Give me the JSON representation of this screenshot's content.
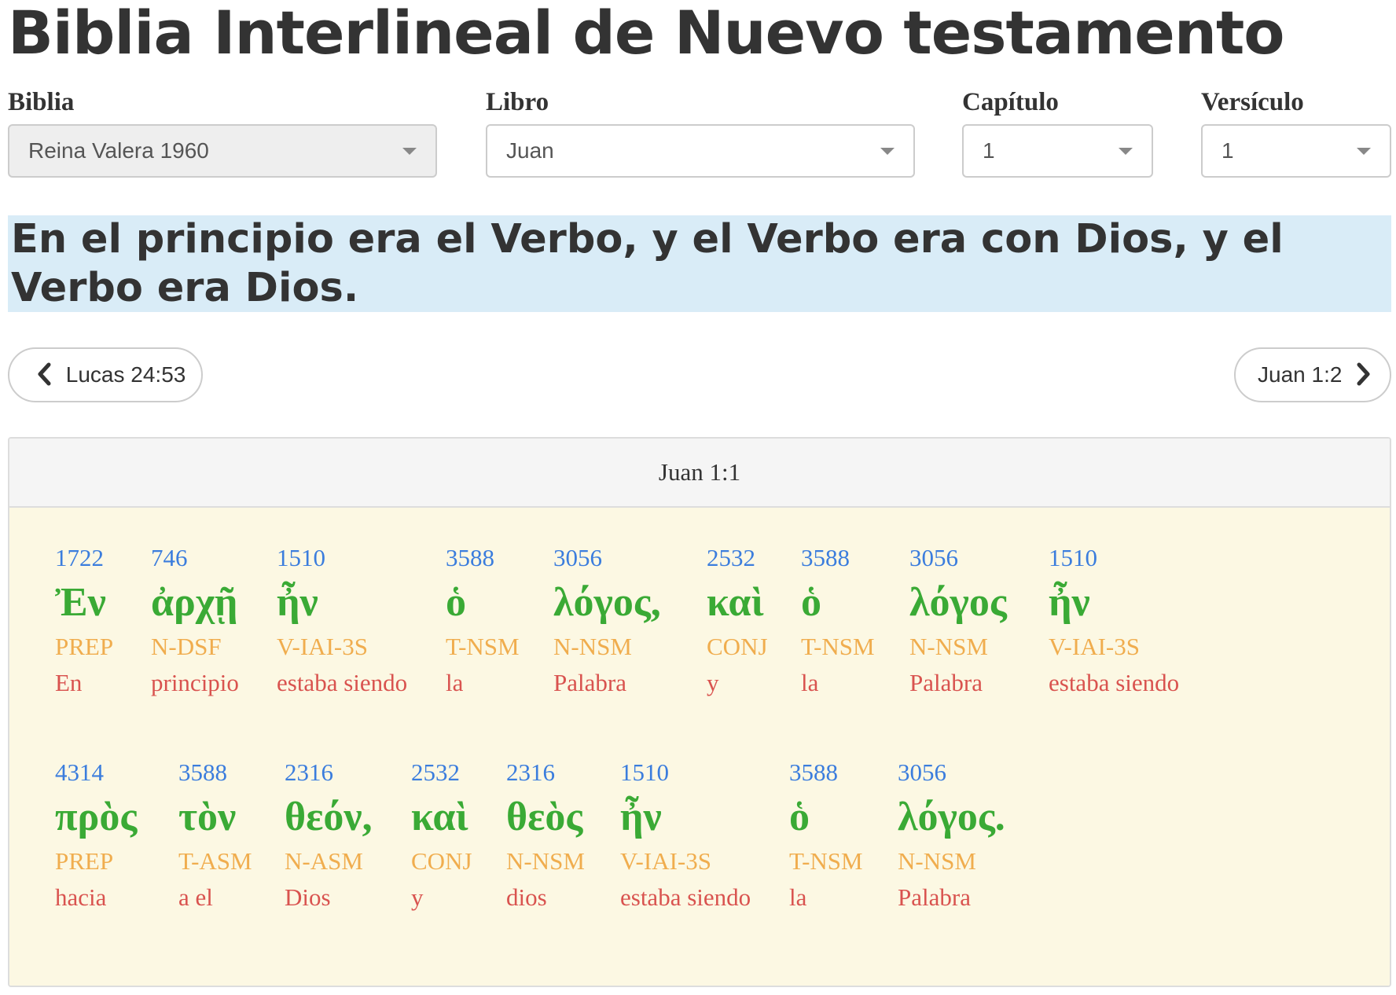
{
  "page": {
    "title": "Biblia Interlineal de Nuevo testamento"
  },
  "selectors": {
    "biblia": {
      "label": "Biblia",
      "value": "Reina Valera 1960",
      "disabled": true
    },
    "libro": {
      "label": "Libro",
      "value": "Juan"
    },
    "capitulo": {
      "label": "Capítulo",
      "value": "1"
    },
    "versiculo": {
      "label": "Versículo",
      "value": "1"
    }
  },
  "verse": {
    "text": "En el principio era el Verbo, y el Verbo era con Dios, y el Verbo era Dios."
  },
  "navigation": {
    "prev_label": "Lucas 24:53",
    "next_label": "Juan 1:2"
  },
  "panel": {
    "heading": "Juan 1:1",
    "words": [
      {
        "strong": "1722",
        "greek": "Ἐν",
        "pos": "PREP",
        "translation": "En"
      },
      {
        "strong": "746",
        "greek": "ἀρχῇ",
        "pos": "N-DSF",
        "translation": "principio"
      },
      {
        "strong": "1510",
        "greek": "ἦν",
        "pos": "V-IAI-3S",
        "translation": "estaba siendo"
      },
      {
        "strong": "3588",
        "greek": "ὁ",
        "pos": "T-NSM",
        "translation": "la"
      },
      {
        "strong": "3056",
        "greek": "λόγος,",
        "pos": "N-NSM",
        "translation": "Palabra"
      },
      {
        "strong": "2532",
        "greek": "καὶ",
        "pos": "CONJ",
        "translation": "y"
      },
      {
        "strong": "3588",
        "greek": "ὁ",
        "pos": "T-NSM",
        "translation": "la"
      },
      {
        "strong": "3056",
        "greek": "λόγος",
        "pos": "N-NSM",
        "translation": "Palabra"
      },
      {
        "strong": "1510",
        "greek": "ἦν",
        "pos": "V-IAI-3S",
        "translation": "estaba siendo"
      },
      {
        "strong": "4314",
        "greek": "πρὸς",
        "pos": "PREP",
        "translation": "hacia"
      },
      {
        "strong": "3588",
        "greek": "τὸν",
        "pos": "T-ASM",
        "translation": "a el"
      },
      {
        "strong": "2316",
        "greek": "θεόν,",
        "pos": "N-ASM",
        "translation": "Dios"
      },
      {
        "strong": "2532",
        "greek": "καὶ",
        "pos": "CONJ",
        "translation": "y"
      },
      {
        "strong": "2316",
        "greek": "θεὸς",
        "pos": "N-NSM",
        "translation": "dios"
      },
      {
        "strong": "1510",
        "greek": "ἦν",
        "pos": "V-IAI-3S",
        "translation": "estaba siendo"
      },
      {
        "strong": "3588",
        "greek": "ὁ",
        "pos": "T-NSM",
        "translation": "la"
      },
      {
        "strong": "3056",
        "greek": "λόγος.",
        "pos": "N-NSM",
        "translation": "Palabra"
      }
    ]
  }
}
